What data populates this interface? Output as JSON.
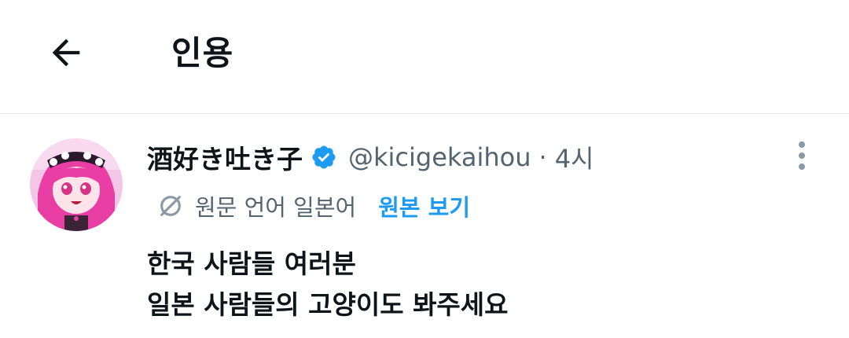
{
  "header": {
    "title": "인용"
  },
  "tweet": {
    "display_name": "酒好き吐き子",
    "handle": "@kicigekaihou",
    "separator": "·",
    "time": "4시",
    "translation": {
      "label": "원문 언어 일본어",
      "show_original": "원본 보기"
    },
    "text_lines": [
      "한국 사람들 여러분",
      "일본 사람들의 고양이도 봐주세요"
    ]
  },
  "icons": {
    "back": "arrow-left-icon",
    "verified": "verified-badge-icon",
    "translate": "translate-icon",
    "more": "more-vertical-icon"
  },
  "colors": {
    "accent": "#1d9bf0",
    "secondary_text": "#536471",
    "primary_text": "#0f1419",
    "divider": "#e7e9ea"
  }
}
